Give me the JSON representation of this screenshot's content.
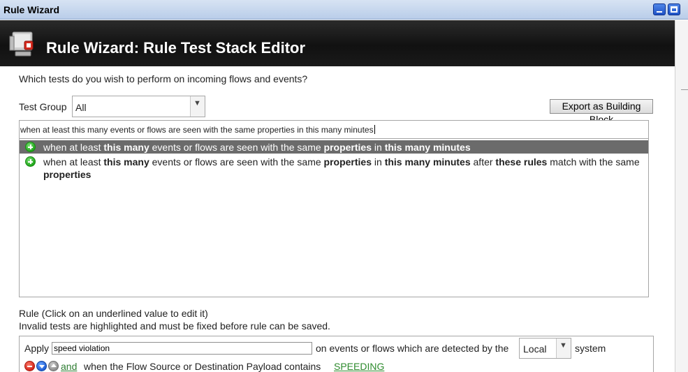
{
  "window": {
    "title": "Rule Wizard"
  },
  "header": {
    "title": "Rule Wizard: Rule Test Stack Editor",
    "icon": "monitor-rule-icon"
  },
  "question": "Which tests do you wish to perform on incoming flows and events?",
  "test_group": {
    "label": "Test Group",
    "selected": "All"
  },
  "export_button": "Export as Building Block",
  "search": {
    "value": "when at least this many events or flows are seen with the same properties in this many minutes"
  },
  "test_list": [
    {
      "selected": true,
      "segments": [
        {
          "text": "when at least ",
          "bold": false
        },
        {
          "text": "this many",
          "bold": true
        },
        {
          "text": " events or flows are seen with the same ",
          "bold": false
        },
        {
          "text": "properties",
          "bold": true
        },
        {
          "text": " in ",
          "bold": false
        },
        {
          "text": "this many minutes",
          "bold": true
        }
      ]
    },
    {
      "selected": false,
      "segments": [
        {
          "text": "when at least ",
          "bold": false
        },
        {
          "text": "this many",
          "bold": true
        },
        {
          "text": " events or flows are seen with the same ",
          "bold": false
        },
        {
          "text": "properties",
          "bold": true
        },
        {
          "text": " in ",
          "bold": false
        },
        {
          "text": "this many minutes",
          "bold": true
        },
        {
          "text": " after ",
          "bold": false
        },
        {
          "text": "these rules",
          "bold": true
        },
        {
          "text": " match with the same ",
          "bold": false
        },
        {
          "text": "properties",
          "bold": true
        }
      ]
    }
  ],
  "rule_section": {
    "line1": "Rule (Click on an underlined value to edit it)",
    "line2": "Invalid tests are highlighted and must be fixed before rule can be saved."
  },
  "rule": {
    "apply_label": "Apply",
    "name_value": "speed violation",
    "on_events_text": "on events or flows which are detected by the",
    "system_selected": "Local",
    "system_label": "system",
    "test_and": " and ",
    "test_text": "when the Flow Source or Destination Payload contains",
    "test_value": "SPEEDING"
  },
  "colors": {
    "header_bg": "#111111",
    "selected_row": "#6b6b6b",
    "link_green": "#2e8b2e"
  }
}
